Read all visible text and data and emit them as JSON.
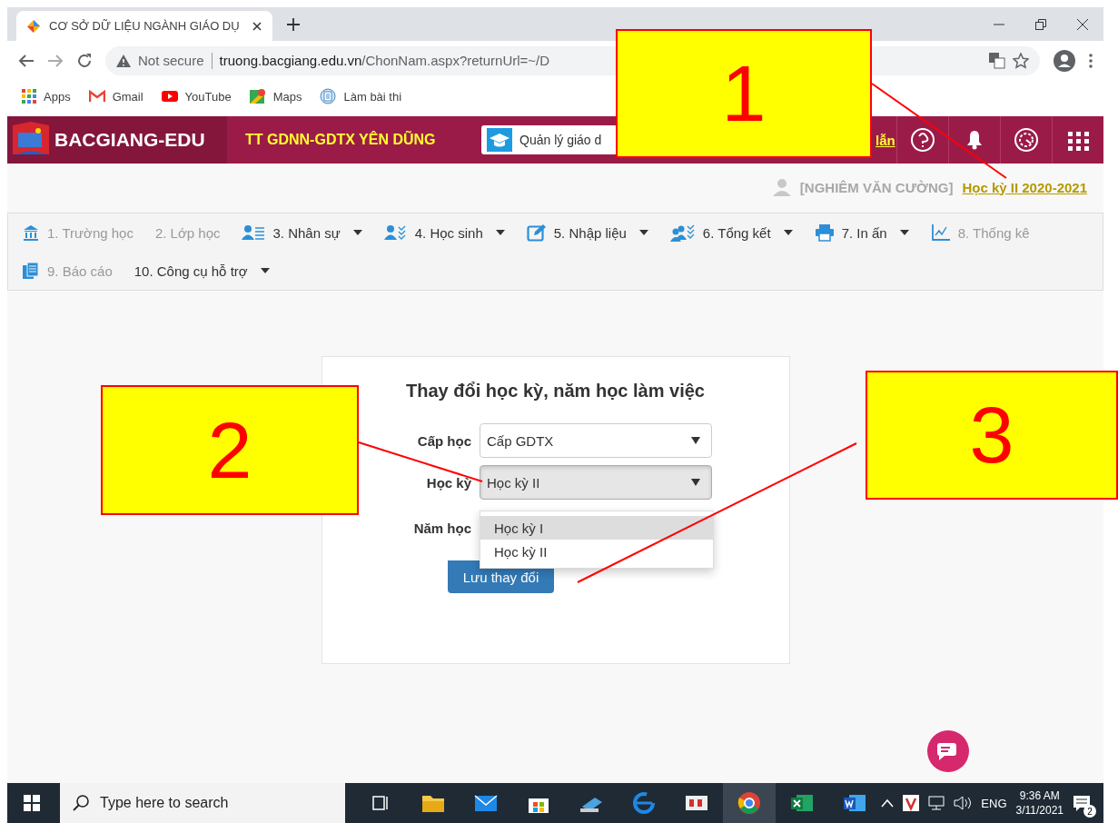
{
  "browser": {
    "tab_title": "CƠ SỞ DỮ LIỆU NGÀNH GIÁO DỤ",
    "security": "Not secure",
    "url_host": "truong.bacgiang.edu.vn",
    "url_path": "/ChonNam.aspx?returnUrl=~/D",
    "bookmarks": [
      {
        "label": "Apps"
      },
      {
        "label": "Gmail"
      },
      {
        "label": "YouTube"
      },
      {
        "label": "Maps"
      },
      {
        "label": "Làm bài thi"
      }
    ]
  },
  "header": {
    "brand": "BACGIANG-EDU",
    "school": "TT GDNN-GDTX YÊN DŨNG",
    "module": "Quản lý giáo d",
    "link": "lẫn"
  },
  "user": {
    "name": "[NGHIÊM VĂN CƯỜNG]",
    "term": "Học kỳ II 2020-2021"
  },
  "menu": [
    {
      "label": "1. Trường học",
      "disabled": true,
      "dropdown": false
    },
    {
      "label": "2. Lớp học",
      "disabled": true,
      "dropdown": false
    },
    {
      "label": "3. Nhân sự",
      "disabled": false,
      "dropdown": true
    },
    {
      "label": "4. Học sinh",
      "disabled": false,
      "dropdown": true
    },
    {
      "label": "5. Nhập liệu",
      "disabled": false,
      "dropdown": true
    },
    {
      "label": "6. Tổng kết",
      "disabled": false,
      "dropdown": true
    },
    {
      "label": "7. In ấn",
      "disabled": false,
      "dropdown": true
    },
    {
      "label": "8. Thống kê",
      "disabled": true,
      "dropdown": false
    },
    {
      "label": "9. Báo cáo",
      "disabled": true,
      "dropdown": false
    },
    {
      "label": "10. Công cụ hỗ trợ",
      "disabled": false,
      "dropdown": true
    }
  ],
  "form": {
    "title": "Thay đổi học kỳ, năm học làm việc",
    "fields": [
      {
        "label": "Cấp học",
        "value": "Cấp GDTX",
        "focused": false
      },
      {
        "label": "Học kỳ",
        "value": "Học kỳ II",
        "focused": true
      },
      {
        "label": "Năm học"
      }
    ],
    "options": [
      {
        "label": "Học kỳ I",
        "selected": true
      },
      {
        "label": "Học kỳ II",
        "selected": false
      }
    ],
    "save_button": "Lưu thay đổi"
  },
  "taskbar": {
    "search_placeholder": "Type here to search",
    "language": "ENG",
    "time": "9:36 AM",
    "date": "3/11/2021",
    "notifications": "2"
  },
  "callouts": [
    {
      "number": "1"
    },
    {
      "number": "2"
    },
    {
      "number": "3"
    }
  ]
}
